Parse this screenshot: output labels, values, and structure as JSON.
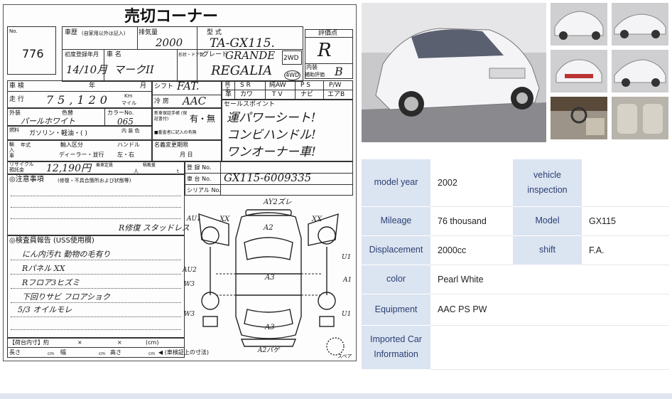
{
  "sheet": {
    "title": "売切コーナー",
    "lot_label": "No.",
    "lot_no": "776",
    "history_label": "車歴",
    "history_note": "(自家用以外は記入)",
    "displacement_label": "排気量",
    "displacement_value": "2000",
    "type_label": "型 式",
    "type_value": "TA-GX115.",
    "grade_score_label": "評価点",
    "grade_score": "R",
    "first_reg_label": "初度登録年月",
    "first_reg_value": "14/10月",
    "car_name_label": "車 名",
    "car_name_value": "マークII",
    "doors_label": "形状・ドア数",
    "grade_label": "グレード",
    "grade_value_1": "GRANDE",
    "grade_value_2": "REGALIA",
    "drive_2wd": "2WD",
    "drive_4wd": "4WD",
    "interior_label": "内装",
    "interior_label2": "補助評価",
    "interior_score": "B",
    "shaken_label": "車 検",
    "shaken_year": "年",
    "shaken_month": "月",
    "mileage_label": "走 行",
    "mileage_value": "75,120",
    "km_label": "Km",
    "mile_label": "マイル",
    "shift_label": "シフト",
    "shift_value": "FAT.",
    "ac_label": "冷 房",
    "ac_value": "AAC",
    "options": [
      "S R",
      "純AW",
      "P S",
      "P/W",
      "革",
      "カワ",
      "T V",
      "ナビ",
      "エアB"
    ],
    "exterior_label": "外装",
    "color_label": "色替",
    "color_value": "パールホワイト",
    "color_no_label": "カラーNo.",
    "color_no_value": "065",
    "interior_color_label": "内 装 色",
    "fuel_label": "燃料",
    "fuel_value": "ガソリン・軽油・(    )",
    "manual_label": "新車保証手帳 (保証書付)",
    "manual_value": "有・無",
    "manual_note": "■番査者に記入の有無",
    "import_label": "輸入区分",
    "handle_label": "ハンドル",
    "import_value": "ディーラー・並行",
    "handle_value": "左・右",
    "year_label": "年式",
    "name_change_label": "名義変更期限",
    "name_change_value": "月  日",
    "sales_point_label": "セールスポイント",
    "sales_point_1": "運パワーシート!",
    "sales_point_2": "コンビハンドル!",
    "sales_point_3": "ワンオーナー車!",
    "recycle_label": "リサイクル 預託金",
    "recycle_value": "12,190円",
    "capacity_label": "乗車定員",
    "capacity_unit": "人",
    "load_label": "積載量",
    "load_unit": "t",
    "reg_label": "登 録 No.",
    "chassis_label": "車 台 No.",
    "chassis_value": "GX115-6009335",
    "serial_label": "シリアル No.",
    "notes_label": "◎注意事項",
    "notes_note": "(修復・不具合箇所および状態等)",
    "repair_note": "R修復 スタッドレス",
    "inspector_label": "◎検査員報告 (USS使用欄)",
    "inspector_1": "にん内汚れ 動物の毛有り",
    "inspector_2": "Rパネル XX",
    "inspector_3": "Rフロア3ヒズミ",
    "inspector_4": "下回りサビ フロアショク",
    "inspector_5": "5/3 オイルモレ",
    "cargo_label": "【荷台内寸】約",
    "length_label": "長さ",
    "width_label": "幅",
    "height_label": "高さ",
    "cm": "cm",
    "times": "×",
    "cm_paren": "(cm)",
    "shaken_note": "◀ (車検証上の寸法)",
    "spare_label": "スペア",
    "diagram_marks": [
      "AY2ズレ",
      "A2",
      "A3",
      "A3",
      "A2バゲ",
      "AU1",
      "XX",
      "XX",
      "AU2",
      "W3",
      "W3",
      "U1",
      "U1",
      "A1"
    ]
  },
  "spec": {
    "model_year_label": "model year",
    "model_year_value": "2002",
    "vehicle_inspection_label": "vehicle inspection",
    "vehicle_inspection_value": "",
    "mileage_label": "Mileage",
    "mileage_value": "76 thousand",
    "model_label": "Model",
    "model_value": "GX115",
    "displacement_label": "Displacement",
    "displacement_value": "2000cc",
    "shift_label": "shift",
    "shift_value": "F.A.",
    "color_label": "color",
    "color_value": "Pearl White",
    "equipment_label": "Equipment",
    "equipment_value": "AAC PS PW",
    "imported_label": "Imported Car Information",
    "imported_value": ""
  },
  "colors": {
    "label_bg": "#dbe4f1",
    "label_text": "#2b3f73",
    "car_body": "#f2f2f4"
  }
}
